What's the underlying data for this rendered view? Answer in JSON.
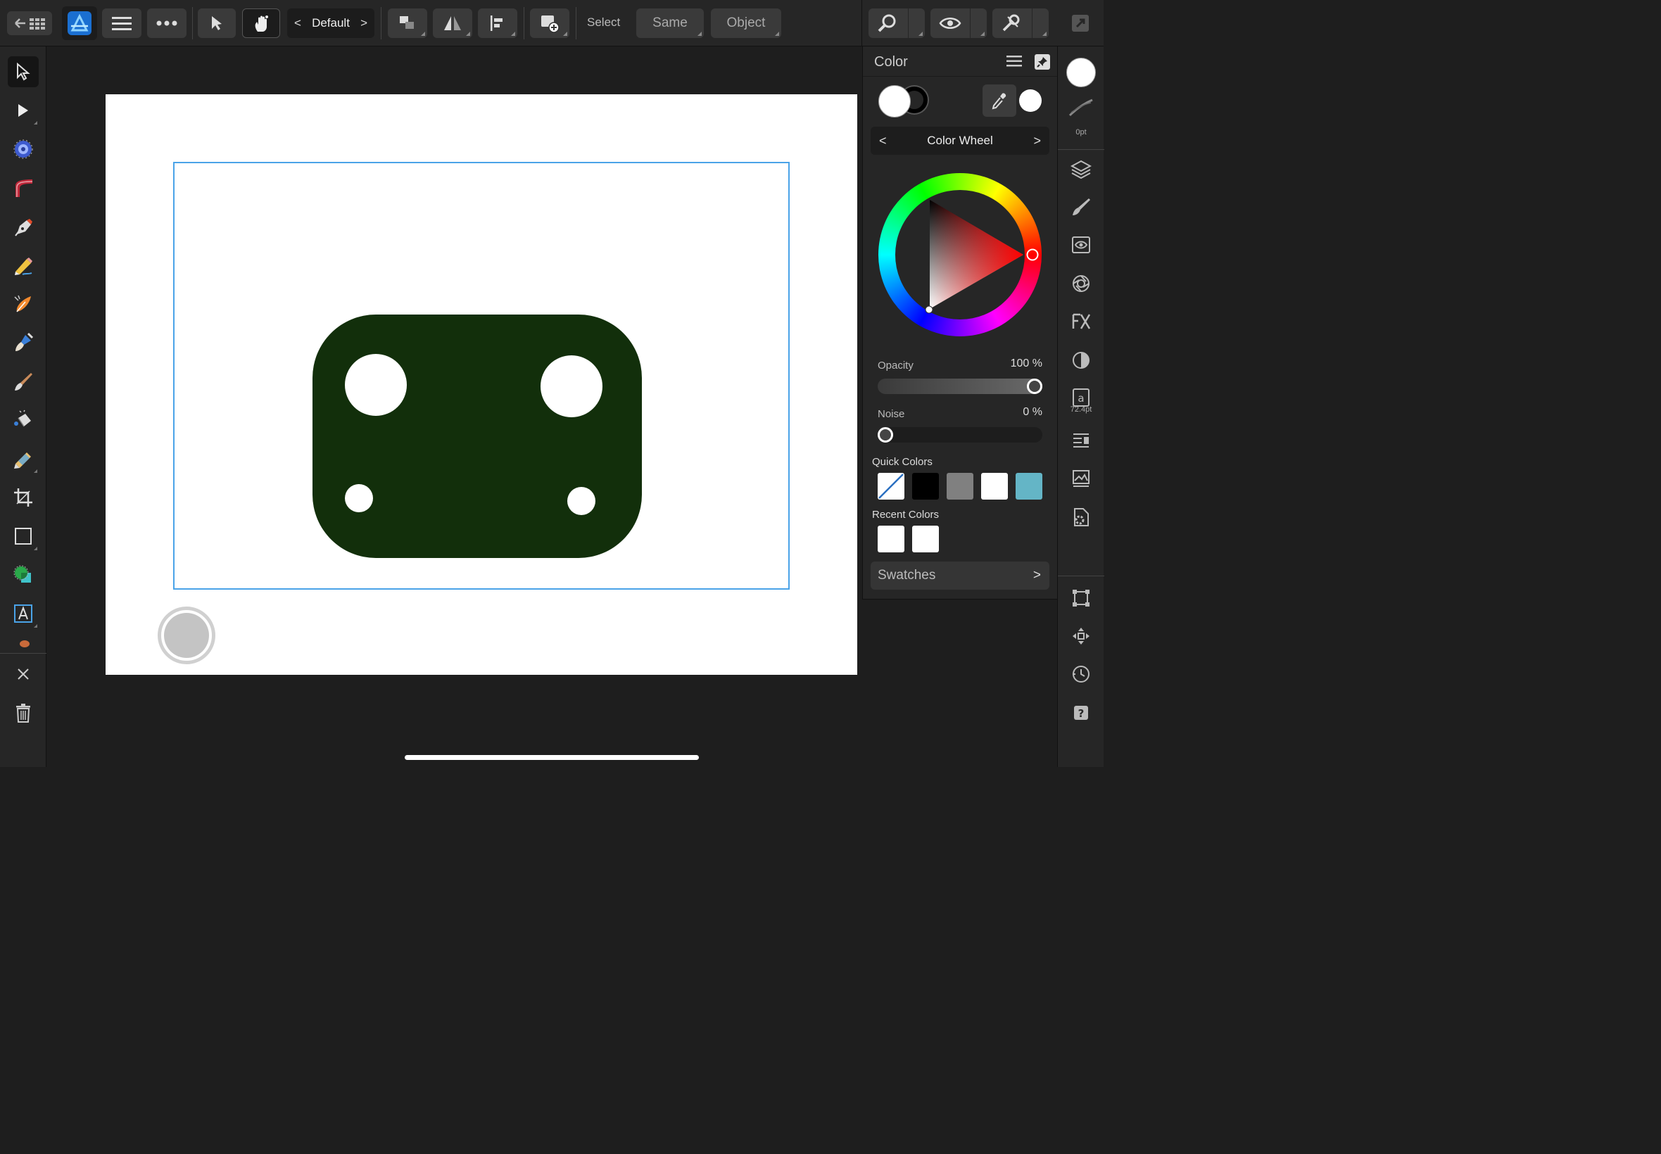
{
  "toolbar": {
    "persona_name": "Default",
    "select_label": "Select",
    "same_label": "Same",
    "object_label": "Object"
  },
  "tools": {
    "left": [
      "move-tool",
      "node-tool",
      "corner-tool",
      "contour-tool",
      "pen-tool",
      "pencil-tool",
      "vector-brush-tool",
      "fill-tool",
      "paint-brush-tool",
      "pixel-tool",
      "transparency-tool",
      "crop-tool",
      "rectangle-tool",
      "shape-builder-tool",
      "text-tool",
      "more-tools"
    ]
  },
  "color_panel": {
    "title": "Color",
    "mode": "Color Wheel",
    "opacity_label": "Opacity",
    "opacity_value": "100 %",
    "opacity_fraction": 1.0,
    "noise_label": "Noise",
    "noise_value": "0 %",
    "noise_fraction": 0.0,
    "quick_colors_label": "Quick Colors",
    "quick_colors": [
      "none",
      "#000000",
      "#808080",
      "#ffffff",
      "#64b5c6"
    ],
    "recent_colors_label": "Recent Colors",
    "recent_colors": [
      "#ffffff",
      "#ffffff"
    ],
    "swatches_label": "Swatches",
    "fill_color": "#ffffff",
    "stroke_color": "#000000",
    "hue_color": "#ff0000"
  },
  "studio": {
    "stroke_width": "0pt",
    "font_size": "72.4pt"
  },
  "document": {
    "shape_fill": "#122f0b",
    "selection_color": "#4aa3e8"
  }
}
